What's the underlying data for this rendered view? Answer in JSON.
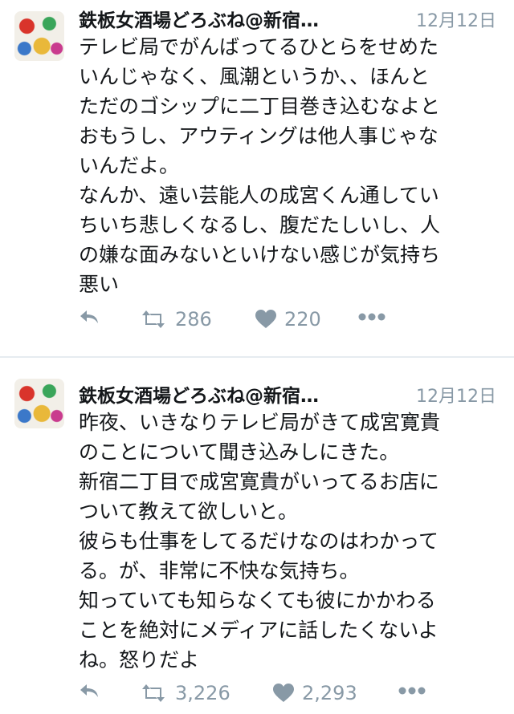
{
  "tweets": [
    {
      "author": "鉄板女酒場どろぶね@新宿…",
      "date": "12月12日",
      "lines": [
        "テレビ局でがんばってるひとらをせめた",
        "いんじゃなく、風潮というか、、ほんと",
        "ただのゴシップに二丁目巻き込むなよと",
        "おもうし、アウティングは他人事じゃな",
        "いんだよ。",
        "なんか、遠い芸能人の成宮くん通してい",
        "ちいち悲しくなるし、腹だたしいし、人",
        "の嫌な面みないといけない感じが気持ち",
        "悪い"
      ],
      "retweets": "286",
      "likes": "220"
    },
    {
      "author": "鉄板女酒場どろぶね@新宿…",
      "date": "12月12日",
      "lines": [
        "昨夜、いきなりテレビ局がきて成宮寛貴",
        "のことについて聞き込みしにきた。",
        "新宿二丁目で成宮寛貴がいってるお店に",
        "ついて教えて欲しいと。",
        "彼らも仕事をしてるだけなのはわかって",
        "る。が、非常に不快な気持ち。",
        "知っていても知らなくても彼にかかわる",
        "ことを絶対にメディアに話したくないよ",
        "ね。怒りだよ"
      ],
      "retweets": "3,226",
      "likes": "2,293"
    }
  ],
  "icons": {
    "reply": "reply-icon",
    "retweet": "retweet-icon",
    "like": "heart-icon",
    "more": "more-icon"
  },
  "colors": {
    "action_gray": "#8899a6",
    "text": "#14171a",
    "divider": "#e6ecf0"
  }
}
